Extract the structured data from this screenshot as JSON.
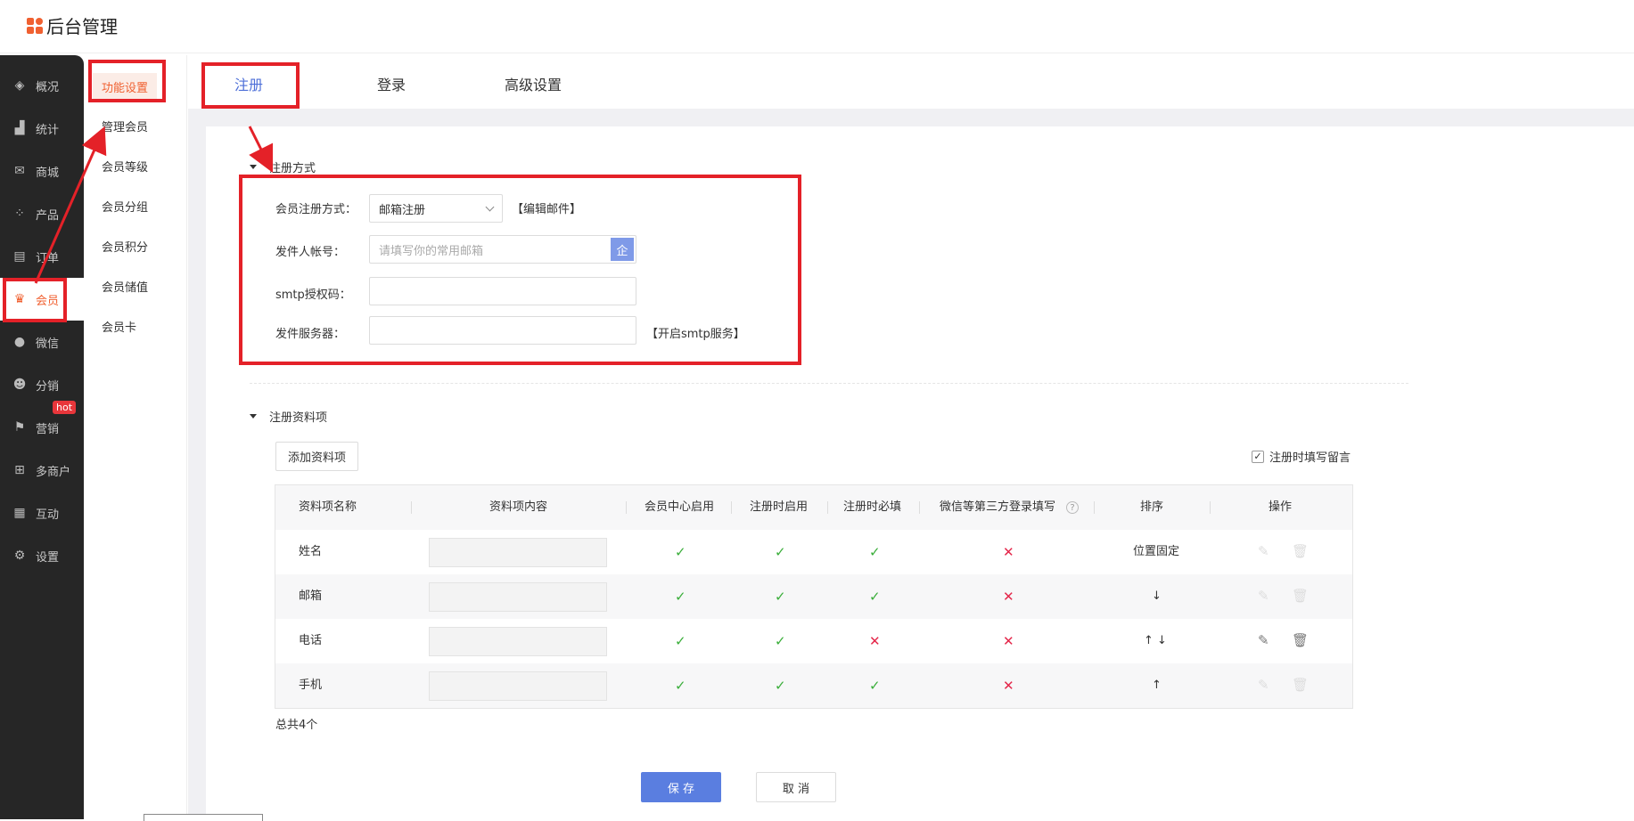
{
  "app": {
    "title": "后台管理"
  },
  "sidebar": {
    "items": [
      {
        "label": "概况",
        "icon": "layers-icon"
      },
      {
        "label": "统计",
        "icon": "chart-icon"
      },
      {
        "label": "商城",
        "icon": "store-icon"
      },
      {
        "label": "产品",
        "icon": "grid-icon"
      },
      {
        "label": "订单",
        "icon": "clipboard-icon"
      },
      {
        "label": "会员",
        "icon": "crown-icon"
      },
      {
        "label": "微信",
        "icon": "wechat-icon"
      },
      {
        "label": "分销",
        "icon": "users-icon"
      },
      {
        "label": "营销",
        "icon": "flag-icon"
      },
      {
        "label": "多商户",
        "icon": "merchant-icon"
      },
      {
        "label": "互动",
        "icon": "interact-icon"
      },
      {
        "label": "设置",
        "icon": "gear-icon"
      }
    ],
    "hot_badge": "hot"
  },
  "subnav": {
    "items": [
      "功能设置",
      "管理会员",
      "会员等级",
      "会员分组",
      "会员积分",
      "会员储值",
      "会员卡"
    ]
  },
  "tabs": [
    "注册",
    "登录",
    "高级设置"
  ],
  "section1": {
    "title": "注册方式",
    "method_label": "会员注册方式：",
    "method_value": "邮箱注册",
    "edit_mail_link": "【编辑邮件】",
    "sender_label": "发件人帐号：",
    "sender_placeholder": "请填写你的常用邮箱",
    "sender_btn": "企",
    "smtp_label": "smtp授权码：",
    "server_label": "发件服务器：",
    "open_smtp_link": "【开启smtp服务】"
  },
  "section2": {
    "title": "注册资料项",
    "add_button": "添加资料项",
    "checkbox_label": "注册时填写留言",
    "checkbox_checked": true
  },
  "table": {
    "headers": [
      "资料项名称",
      "资料项内容",
      "会员中心启用",
      "注册时启用",
      "注册时必填",
      "微信等第三方登录填写",
      "排序",
      "操作"
    ],
    "help_icon": "?",
    "rows": [
      {
        "name": "姓名",
        "member_center": "✓",
        "reg_enable": "✓",
        "reg_required": "✓",
        "third_party": "✕",
        "sort": "位置固定",
        "editable": false
      },
      {
        "name": "邮箱",
        "member_center": "✓",
        "reg_enable": "✓",
        "reg_required": "✓",
        "third_party": "✕",
        "sort": "↓",
        "editable": false
      },
      {
        "name": "电话",
        "member_center": "✓",
        "reg_enable": "✓",
        "reg_required": "✕",
        "third_party": "✕",
        "sort": "↑ ↓",
        "editable": true
      },
      {
        "name": "手机",
        "member_center": "✓",
        "reg_enable": "✓",
        "reg_required": "✓",
        "third_party": "✕",
        "sort": "↑",
        "editable": false
      }
    ],
    "total": "总共4个"
  },
  "footer": {
    "save": "保 存",
    "cancel": "取 消"
  },
  "colors": {
    "accent": "#f06030",
    "primary": "#5a7ee0",
    "annotation": "#e42128",
    "check": "#3aae3a",
    "cross": "#e4274a"
  }
}
